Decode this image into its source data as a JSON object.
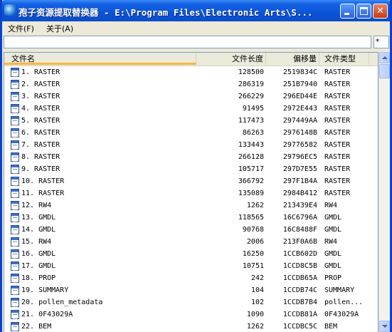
{
  "window": {
    "title": "孢子资源提取替换器 - E:\\Program Files\\Electronic Arts\\S...",
    "minimize_icon": "minimize-icon",
    "maximize_icon": "maximize-icon",
    "close_icon": "close-icon",
    "close_label": "✕"
  },
  "menu": {
    "file": "文件(F)",
    "about": "关于(A)"
  },
  "path_field": {
    "value": ""
  },
  "filter_field": {
    "value": "*"
  },
  "table": {
    "columns": {
      "name": "文件名",
      "size": "文件长度",
      "offset": "偏移量",
      "type": "文件类型"
    },
    "rows": [
      {
        "name": "1. RASTER",
        "size": "128500",
        "offset": "2519834C",
        "type": "RASTER"
      },
      {
        "name": "2. RASTER",
        "size": "286319",
        "offset": "251B7940",
        "type": "RASTER"
      },
      {
        "name": "3. RASTER",
        "size": "266229",
        "offset": "296ED44E",
        "type": "RASTER"
      },
      {
        "name": "4. RASTER",
        "size": "91495",
        "offset": "2972E443",
        "type": "RASTER"
      },
      {
        "name": "5. RASTER",
        "size": "117473",
        "offset": "297449AA",
        "type": "RASTER"
      },
      {
        "name": "6. RASTER",
        "size": "86263",
        "offset": "2976148B",
        "type": "RASTER"
      },
      {
        "name": "7. RASTER",
        "size": "133443",
        "offset": "29776582",
        "type": "RASTER"
      },
      {
        "name": "8. RASTER",
        "size": "266128",
        "offset": "29796EC5",
        "type": "RASTER"
      },
      {
        "name": "9. RASTER",
        "size": "105717",
        "offset": "297D7E55",
        "type": "RASTER"
      },
      {
        "name": "10. RASTER",
        "size": "366792",
        "offset": "297F1B4A",
        "type": "RASTER"
      },
      {
        "name": "11. RASTER",
        "size": "135089",
        "offset": "2984B412",
        "type": "RASTER"
      },
      {
        "name": "12. RW4",
        "size": "1262",
        "offset": "213439E4",
        "type": "RW4"
      },
      {
        "name": "13. GMDL",
        "size": "118565",
        "offset": "16C6796A",
        "type": "GMDL"
      },
      {
        "name": "14. GMDL",
        "size": "90768",
        "offset": "16C8488F",
        "type": "GMDL"
      },
      {
        "name": "15. RW4",
        "size": "2006",
        "offset": "213F0A6B",
        "type": "RW4"
      },
      {
        "name": "16. GMDL",
        "size": "16250",
        "offset": "1CCB602D",
        "type": "GMDL"
      },
      {
        "name": "17. GMDL",
        "size": "10751",
        "offset": "1CCD8C5B",
        "type": "GMDL"
      },
      {
        "name": "18. PROP",
        "size": "242",
        "offset": "1CCDB65A",
        "type": "PROP"
      },
      {
        "name": "19. SUMMARY",
        "size": "104",
        "offset": "1CCDB74C",
        "type": "SUMMARY"
      },
      {
        "name": "20. pollen_metadata",
        "size": "102",
        "offset": "1CCDB7B4",
        "type": "pollen..."
      },
      {
        "name": "21. 0F43029A",
        "size": "1090",
        "offset": "1CCDB81A",
        "type": "0F43029A"
      },
      {
        "name": "22. BEM",
        "size": "1262",
        "offset": "1CCDBC5C",
        "type": "BEM"
      }
    ]
  }
}
